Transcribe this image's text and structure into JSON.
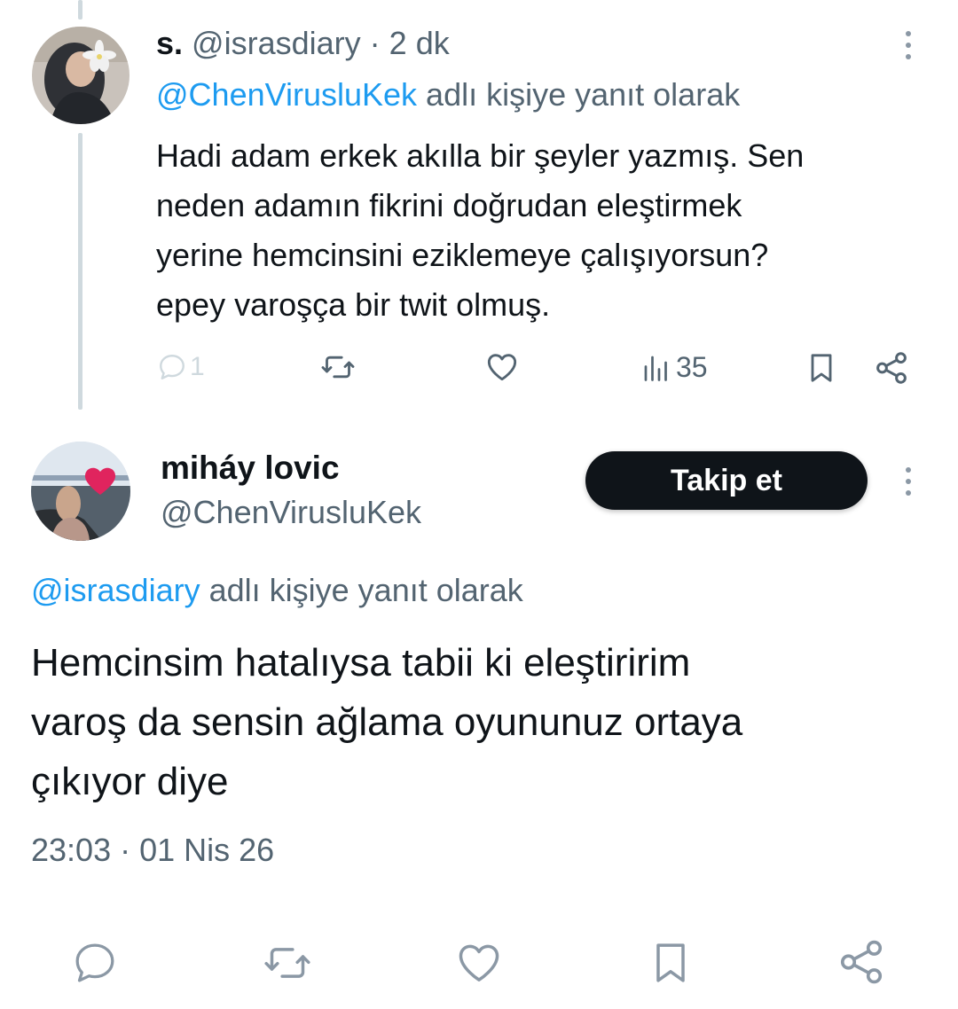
{
  "reply1": {
    "display_name": "s.",
    "handle": "@israsdiary",
    "separator": "·",
    "time": "2 dk",
    "reply_to_handle": "@ChenVirusluKek",
    "reply_to_suffix": "adlı kişiye yanıt olarak",
    "body_lines": [
      "Hadi adam erkek akılla bir şeyler yazmış. Sen",
      "neden adamın fikrini doğrudan eleştirmek",
      "yerine hemcinsini eziklemeye çalışıyorsun?",
      "epey varoşça bir twit olmuş."
    ],
    "reply_count": "1",
    "view_count": "35",
    "icons": [
      "reply-icon",
      "retweet-icon",
      "like-icon",
      "views-icon",
      "bookmark-icon",
      "share-icon",
      "more-icon"
    ]
  },
  "main_tweet": {
    "display_name": "miháy lovic",
    "handle": "@ChenVirusluKek",
    "follow_label": "Takip et",
    "reply_to_handle": "@israsdiary",
    "reply_to_suffix": "adlı kişiye yanıt olarak",
    "body_lines": [
      "Hemcinsim hatalıysa tabii ki eleştiririm",
      "varoş da sensin ağlama oyununuz ortaya",
      "çıkıyor diye"
    ],
    "timestamp": "23:03 · 01 Nis 26",
    "icons": [
      "reply-icon",
      "retweet-icon",
      "like-icon",
      "bookmark-icon",
      "share-icon",
      "more-icon"
    ]
  },
  "colors": {
    "text": "#0f1419",
    "secondary": "#536471",
    "link": "#1d9bf0",
    "thread_line": "#cfd9de",
    "button_bg": "#0f1419",
    "heart": "#e0245e"
  }
}
